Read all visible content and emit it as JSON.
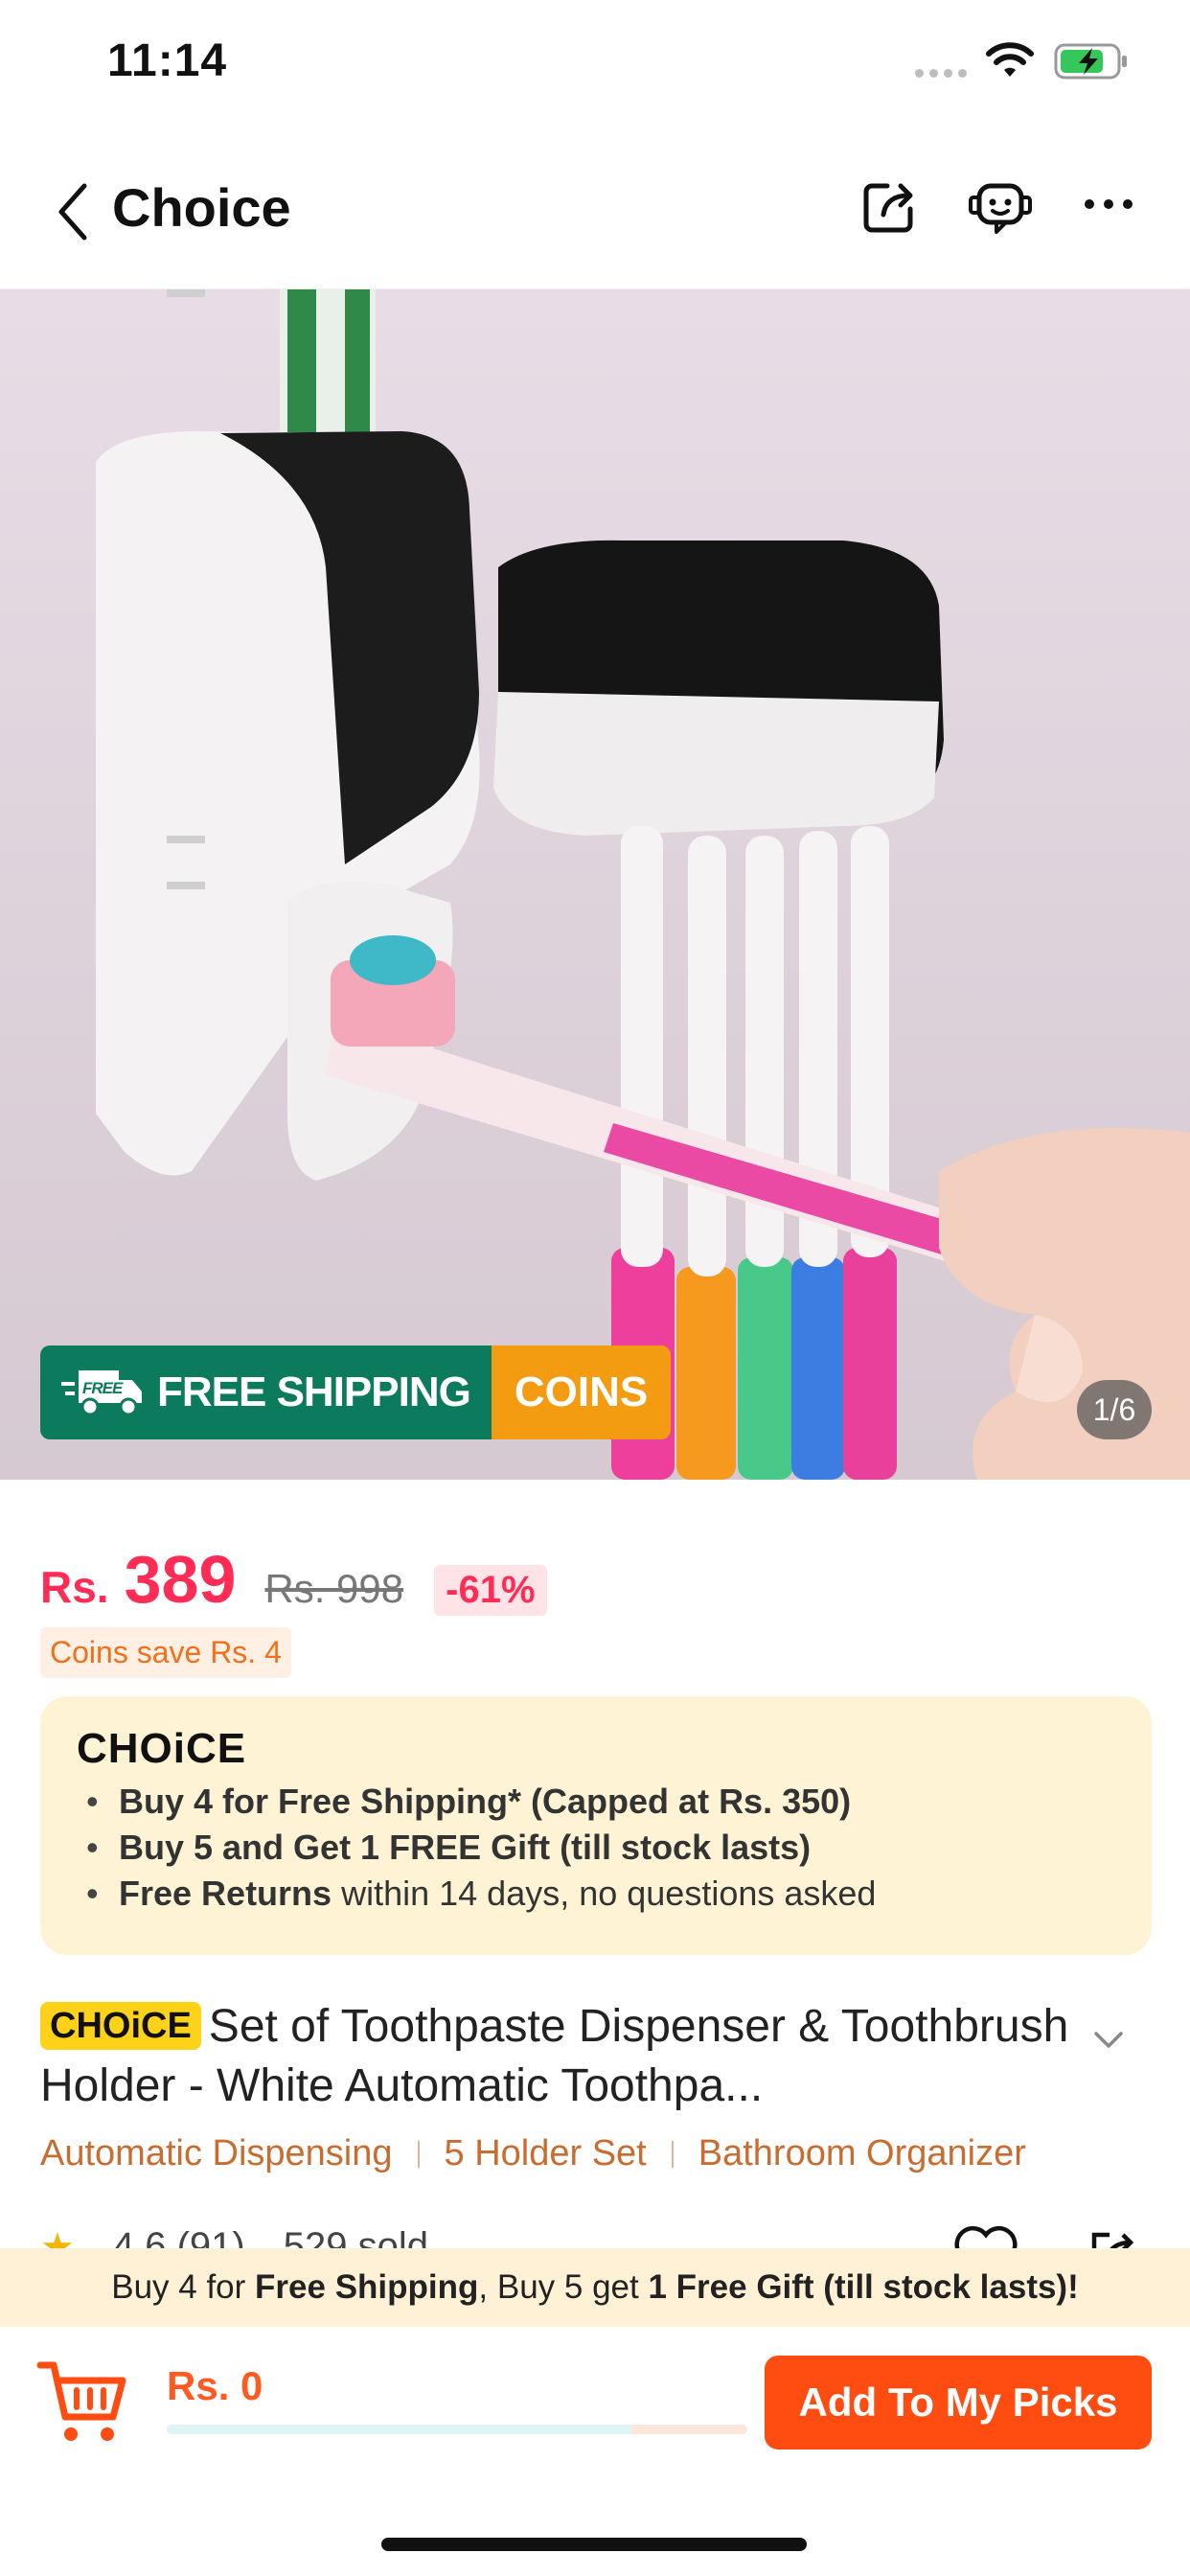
{
  "status_bar": {
    "time": "11:14"
  },
  "nav": {
    "title": "Choice"
  },
  "gallery": {
    "page_counter": "1/6",
    "banner_free_icon_text": "FREE",
    "banner_free": "FREE SHIPPING",
    "banner_coins": "COINS"
  },
  "price": {
    "currency": "Rs.",
    "current": "389",
    "original": "Rs. 998",
    "discount": "-61%",
    "coins_save": "Coins save Rs. 4"
  },
  "choice_card": {
    "logo": "CHOiCE",
    "bullets": [
      {
        "bold": "Buy 4 for  Free Shipping* (Capped at Rs. 350)",
        "rest": ""
      },
      {
        "bold": "Buy 5 and Get 1 FREE Gift (till stock lasts)",
        "rest": ""
      },
      {
        "bold": "Free Returns",
        "rest": " within 14 days, no questions asked"
      }
    ]
  },
  "product": {
    "badge": "CHOiCE",
    "title": "Set of Toothpaste Dispenser & Toothbrush Holder - White Automatic Toothpa...",
    "tags": [
      "Automatic Dispensing",
      "5 Holder Set",
      "Bathroom Organizer"
    ],
    "rating": "4.6 (91)",
    "sold": "529 sold"
  },
  "notice": {
    "part1": "Buy 4 for ",
    "bold1": "Free Shipping",
    "part2": ", Buy 5 get ",
    "bold2": "1 Free Gift (till stock lasts)!"
  },
  "cart": {
    "total": "Rs. 0",
    "progress": 0.0,
    "add_label": "Add To My Picks"
  },
  "colors": {
    "accent": "#ff4d12",
    "price": "#ff2d55",
    "free_shipping": "#0c7a5c",
    "coins": "#f39c12",
    "choice_yellow": "#ffd21a"
  }
}
